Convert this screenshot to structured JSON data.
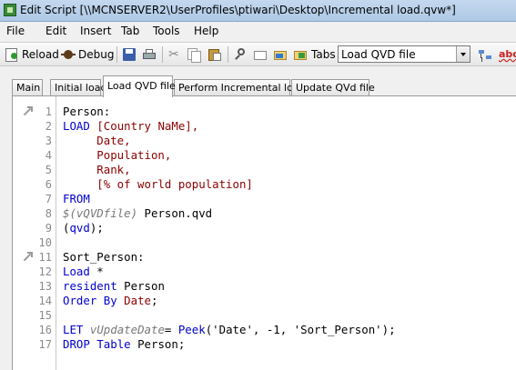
{
  "window": {
    "title": "Edit Script [\\\\MCNSERVER2\\UserProfiles\\ptiwari\\Desktop\\Incremental load.qvw*]"
  },
  "menu": [
    "File",
    "Edit",
    "Insert",
    "Tab",
    "Tools",
    "Help"
  ],
  "toolbar": {
    "reload_label": "Reload",
    "debug_label": "Debug",
    "tabs_label": "Tabs",
    "tab_select_value": "Load QVD file"
  },
  "tabs": [
    {
      "label": "Main",
      "active": false
    },
    {
      "label": "Initial load",
      "active": false
    },
    {
      "label": "Load QVD file",
      "active": true
    },
    {
      "label": "Perform Incremental load",
      "active": false
    },
    {
      "label": "Update QVd file",
      "active": false
    }
  ],
  "editor": {
    "lines": [
      {
        "n": "1",
        "marker": true,
        "segs": [
          [
            "Person:",
            "plain"
          ]
        ]
      },
      {
        "n": "2",
        "segs": [
          [
            "LOAD ",
            "kw"
          ],
          [
            "[Country NaMe],",
            "fld"
          ]
        ]
      },
      {
        "n": "3",
        "segs": [
          [
            "     Date,",
            "fld"
          ]
        ]
      },
      {
        "n": "4",
        "segs": [
          [
            "     Population,",
            "fld"
          ]
        ]
      },
      {
        "n": "5",
        "segs": [
          [
            "     Rank,",
            "fld"
          ]
        ]
      },
      {
        "n": "6",
        "segs": [
          [
            "     [% of world population]",
            "fld"
          ]
        ]
      },
      {
        "n": "7",
        "segs": [
          [
            "FROM",
            "kw"
          ]
        ]
      },
      {
        "n": "8",
        "segs": [
          [
            "$(vQVDfile)",
            "var"
          ],
          [
            " Person.qvd",
            "plain"
          ]
        ]
      },
      {
        "n": "9",
        "segs": [
          [
            "(",
            "plain"
          ],
          [
            "qvd",
            "kw"
          ],
          [
            ");",
            "plain"
          ]
        ]
      },
      {
        "n": "10",
        "segs": []
      },
      {
        "n": "11",
        "marker": true,
        "segs": [
          [
            "Sort_Person:",
            "plain"
          ]
        ]
      },
      {
        "n": "12",
        "segs": [
          [
            "Load",
            "kw"
          ],
          [
            " *",
            "plain"
          ]
        ]
      },
      {
        "n": "13",
        "segs": [
          [
            "resident",
            "kw"
          ],
          [
            " Person",
            "plain"
          ]
        ]
      },
      {
        "n": "14",
        "segs": [
          [
            "Order By",
            "kw"
          ],
          [
            " ",
            "plain"
          ],
          [
            "Date",
            "fld"
          ],
          [
            ";",
            "plain"
          ]
        ]
      },
      {
        "n": "15",
        "segs": []
      },
      {
        "n": "16",
        "segs": [
          [
            "LET",
            "kw"
          ],
          [
            " ",
            "plain"
          ],
          [
            "vUpdateDate",
            "var"
          ],
          [
            "= ",
            "plain"
          ],
          [
            "Peek",
            "kw"
          ],
          [
            "('Date', -1, 'Sort_Person');",
            "plain"
          ]
        ]
      },
      {
        "n": "17",
        "segs": [
          [
            "DROP",
            "kw"
          ],
          [
            " ",
            "plain"
          ],
          [
            "Table",
            "kw"
          ],
          [
            " Person;",
            "plain"
          ]
        ]
      }
    ]
  }
}
